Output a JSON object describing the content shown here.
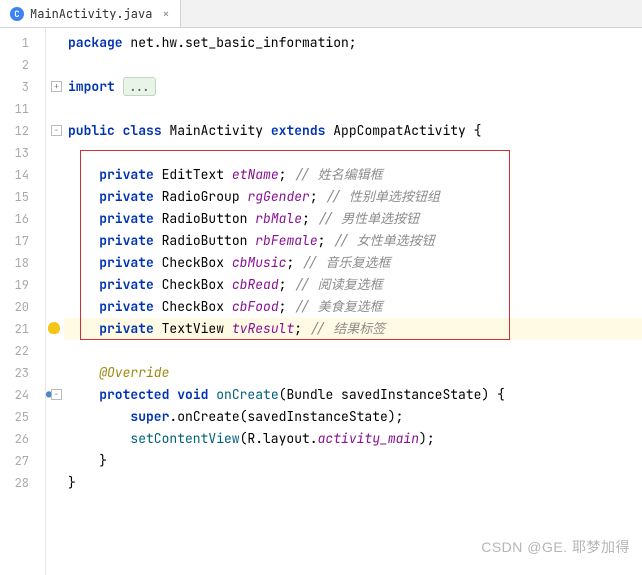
{
  "tab": {
    "icon_label": "C",
    "title": "MainActivity.java",
    "close": "×"
  },
  "gutter_lines": [
    "1",
    "2",
    "3",
    "11",
    "12",
    "13",
    "14",
    "15",
    "16",
    "17",
    "18",
    "19",
    "20",
    "21",
    "22",
    "23",
    "24",
    "25",
    "26",
    "27",
    "28"
  ],
  "code": {
    "l1_kw": "package",
    "l1_pkg": " net.hw.set_basic_information;",
    "l3_kw": "import",
    "l3_fold": "...",
    "l12_public": "public",
    "l12_class": "class",
    "l12_name": " MainActivity ",
    "l12_extends": "extends",
    "l12_super": " AppCompatActivity {",
    "fields": [
      {
        "type": "EditText",
        "name": "etName",
        "comment": "// 姓名编辑框"
      },
      {
        "type": "RadioGroup",
        "name": "rgGender",
        "comment": "// 性别单选按钮组"
      },
      {
        "type": "RadioButton",
        "name": "rbMale",
        "comment": "// 男性单选按钮"
      },
      {
        "type": "RadioButton",
        "name": "rbFemale",
        "comment": "// 女性单选按钮"
      },
      {
        "type": "CheckBox",
        "name": "cbMusic",
        "comment": "// 音乐复选框"
      },
      {
        "type": "CheckBox",
        "name": "cbRead",
        "comment": "// 阅读复选框"
      },
      {
        "type": "CheckBox",
        "name": "cbFood",
        "comment": "// 美食复选框"
      },
      {
        "type": "TextView",
        "name": "tvResult",
        "comment": "// 结果标签"
      }
    ],
    "private_kw": "private",
    "override": "@Override",
    "l24_protected": "protected",
    "l24_void": "void",
    "l24_method": "onCreate",
    "l24_params": "(Bundle savedInstanceState) {",
    "l25_super": "super",
    "l25_call": ".onCreate(savedInstanceState);",
    "l26_method": "setContentView",
    "l26_arg1": "(R.layout.",
    "l26_arg2": "activity_main",
    "l26_arg3": ");",
    "l27": "}",
    "l28": "}"
  },
  "watermark": "CSDN @GE. 耶梦加得"
}
